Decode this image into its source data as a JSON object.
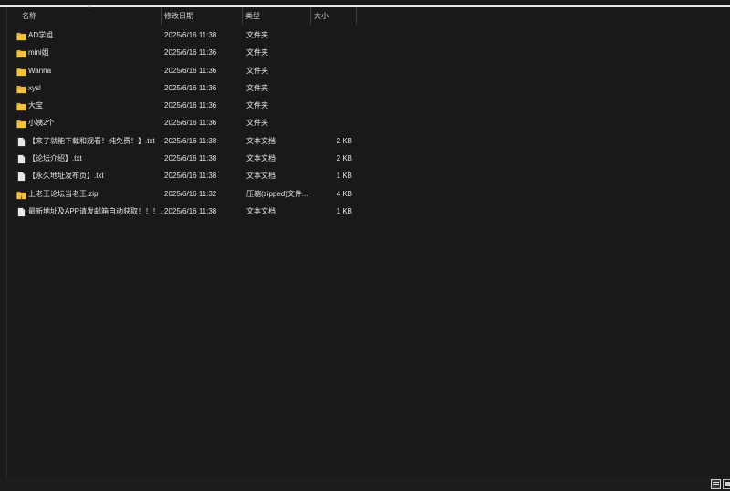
{
  "columns": {
    "name": "名称",
    "date": "修改日期",
    "type": "类型",
    "size": "大小"
  },
  "files": [
    {
      "name": "AD学姐",
      "date": "2025/6/16 11:38",
      "type": "文件夹",
      "size": "",
      "icon": "folder-icon"
    },
    {
      "name": "mini姐",
      "date": "2025/6/16 11:36",
      "type": "文件夹",
      "size": "",
      "icon": "folder-icon"
    },
    {
      "name": "Wanna",
      "date": "2025/6/16 11:36",
      "type": "文件夹",
      "size": "",
      "icon": "folder-icon"
    },
    {
      "name": "xysl",
      "date": "2025/6/16 11:36",
      "type": "文件夹",
      "size": "",
      "icon": "folder-icon"
    },
    {
      "name": "大宝",
      "date": "2025/6/16 11:36",
      "type": "文件夹",
      "size": "",
      "icon": "folder-icon"
    },
    {
      "name": "小姨2个",
      "date": "2025/6/16 11:36",
      "type": "文件夹",
      "size": "",
      "icon": "folder-icon"
    },
    {
      "name": "【来了就能下载和观看！纯免费！】.txt",
      "date": "2025/6/16 11:38",
      "type": "文本文档",
      "size": "2 KB",
      "icon": "text-file-icon"
    },
    {
      "name": "【论坛介绍】.txt",
      "date": "2025/6/16 11:38",
      "type": "文本文档",
      "size": "2 KB",
      "icon": "text-file-icon"
    },
    {
      "name": "【永久地址发布页】.txt",
      "date": "2025/6/16 11:38",
      "type": "文本文档",
      "size": "1 KB",
      "icon": "text-file-icon"
    },
    {
      "name": "上老王论坛当老王.zip",
      "date": "2025/6/16 11:32",
      "type": "压缩(zipped)文件...",
      "size": "4 KB",
      "icon": "zip-folder-icon"
    },
    {
      "name": "最新地址及APP请发邮箱自动获取！！！...",
      "date": "2025/6/16 11:38",
      "type": "文本文档",
      "size": "1 KB",
      "icon": "text-file-icon"
    }
  ],
  "colors": {
    "background": "#191919",
    "folder": "#f5c242",
    "folder_dark": "#d9a520",
    "text": "#e4e4e4",
    "file_page": "#e8e8e8"
  }
}
